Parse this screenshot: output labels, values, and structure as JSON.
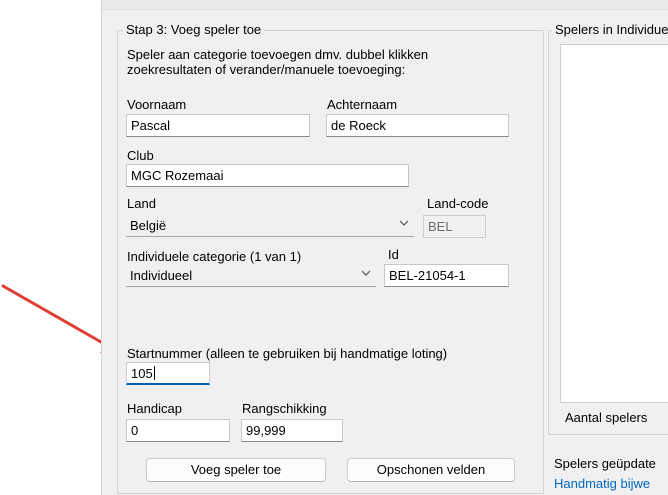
{
  "step3": {
    "title": "Stap 3: Voeg speler toe",
    "instruction_line1": "Speler aan categorie toevoegen dmv. dubbel klikken",
    "instruction_line2": "zoekresultaten of verander/manuele toevoeging:",
    "first_name": {
      "label": "Voornaam",
      "value": "Pascal"
    },
    "last_name": {
      "label": "Achternaam",
      "value": "de Roeck"
    },
    "club": {
      "label": "Club",
      "value": "MGC Rozemaai"
    },
    "country": {
      "label": "Land",
      "value": "België"
    },
    "country_code": {
      "label": "Land-code",
      "value": "BEL"
    },
    "category": {
      "label": "Individuele categorie (1 van 1)",
      "value": "Individueel"
    },
    "id": {
      "label": "Id",
      "value": "BEL-21054-1"
    },
    "start_number": {
      "label": "Startnummer (alleen te gebruiken bij handmatige loting)",
      "value": "105"
    },
    "handicap": {
      "label": "Handicap",
      "value": "0"
    },
    "ranking": {
      "label": "Rangschikking",
      "value": "99,999"
    },
    "add_button": "Voeg speler toe",
    "clear_button": "Opschonen velden"
  },
  "players_panel": {
    "title": "Spelers in Individue",
    "count_label": "Aantal spelers",
    "updated_label": "Spelers geüpdate",
    "manual_link": "Handmatig bijwe"
  },
  "annotation": {
    "color": "#e03c31"
  }
}
